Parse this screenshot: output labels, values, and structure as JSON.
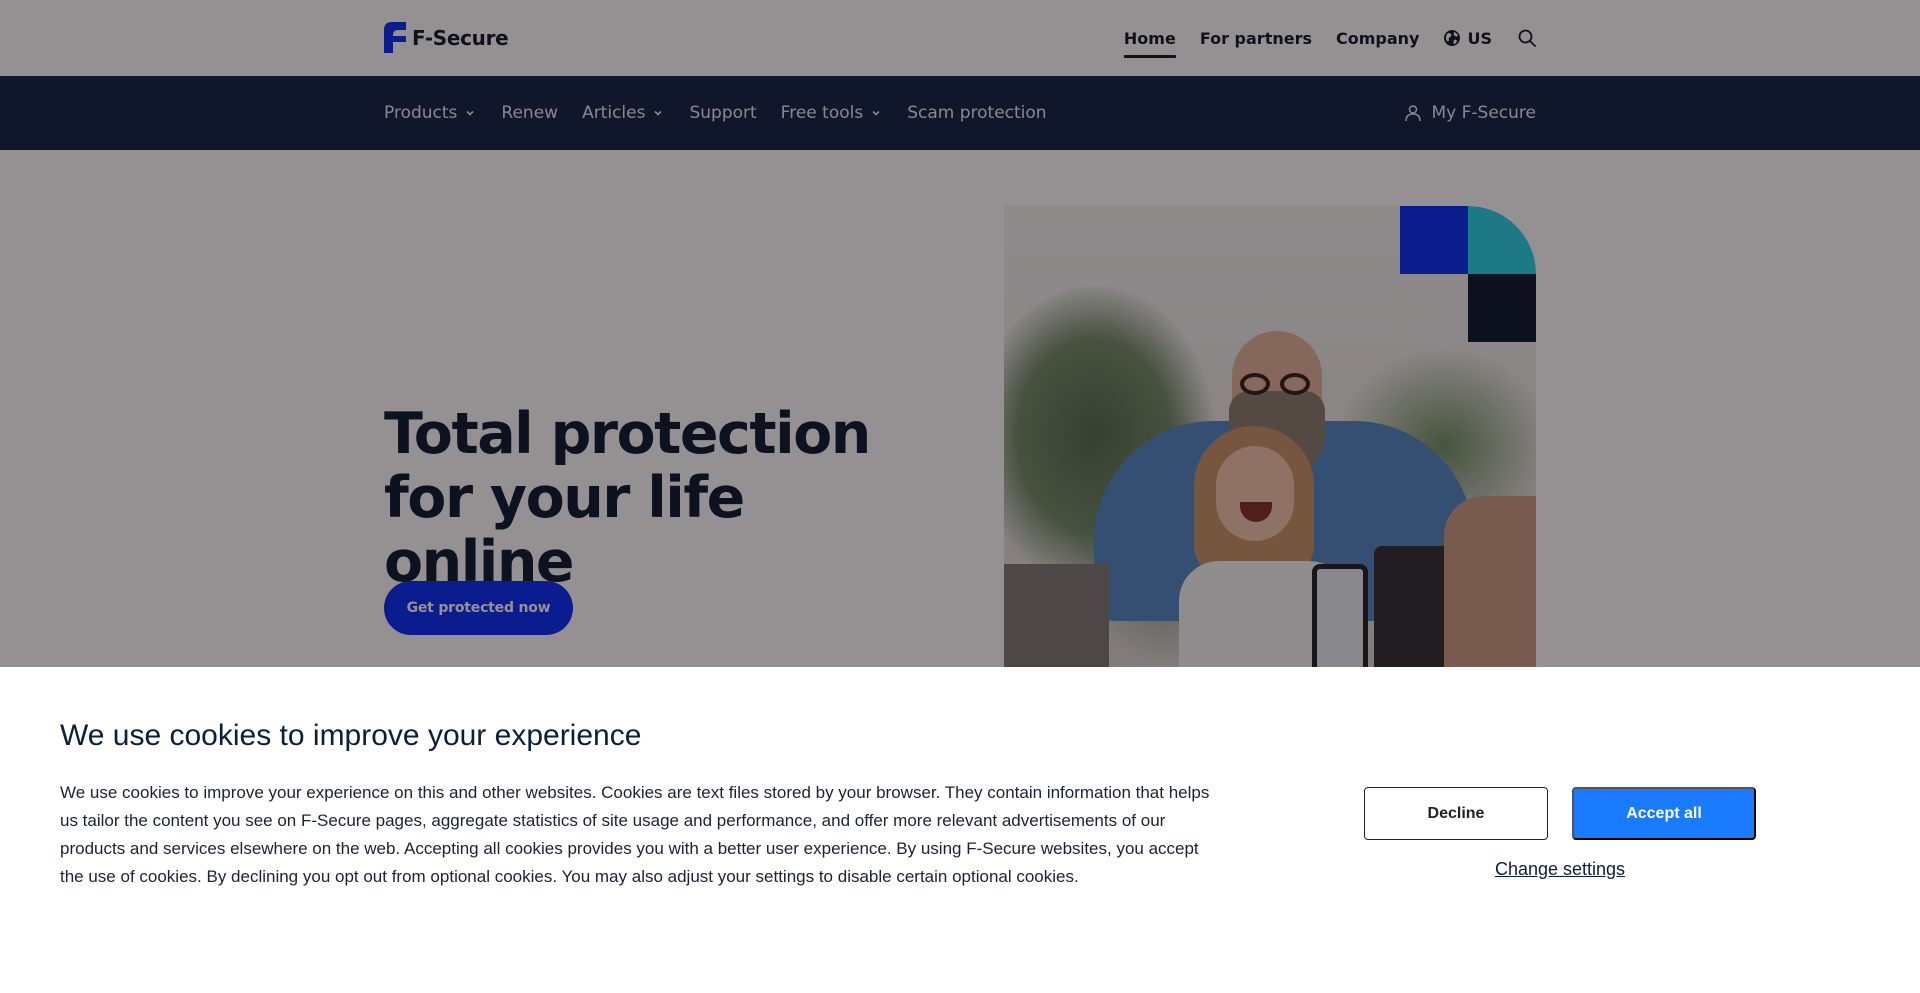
{
  "brand": {
    "name": "F-Secure",
    "colors": {
      "navy": "#0b1e3e",
      "blue": "#0027f5",
      "teal": "#22d3e6",
      "accept_blue": "#1a7bff"
    }
  },
  "top_nav": {
    "items": [
      {
        "label": "Home",
        "active": true
      },
      {
        "label": "For partners",
        "active": false
      },
      {
        "label": "Company",
        "active": false
      }
    ],
    "region": {
      "icon": "globe-icon",
      "label": "US"
    },
    "search": {
      "icon": "search-icon"
    }
  },
  "main_nav": {
    "items": [
      {
        "label": "Products",
        "has_dropdown": true
      },
      {
        "label": "Renew",
        "has_dropdown": false
      },
      {
        "label": "Articles",
        "has_dropdown": true
      },
      {
        "label": "Support",
        "has_dropdown": false
      },
      {
        "label": "Free tools",
        "has_dropdown": true
      },
      {
        "label": "Scam protection",
        "has_dropdown": false
      }
    ],
    "account": {
      "icon": "user-icon",
      "label": "My F-Secure"
    }
  },
  "hero": {
    "title": "Total protection for your life online",
    "cta_label": "Get protected now",
    "image_alt": "Man and laughing girl recording a video with a phone"
  },
  "cookie_banner": {
    "title": "We use cookies to improve your experience",
    "body": "We use cookies to improve your experience on this and other websites. Cookies are text files stored by your browser. They contain information that helps us tailor the content you see on F-Secure pages, aggregate statistics of site usage and performance, and offer more relevant advertisements of our products and services elsewhere on the web. Accepting all cookies provides you with a better user experience. By using F-Secure websites, you accept the use of cookies. By declining you opt out from optional cookies. You may also adjust your settings to disable certain optional cookies.",
    "decline_label": "Decline",
    "accept_label": "Accept all",
    "settings_label": "Change settings"
  }
}
